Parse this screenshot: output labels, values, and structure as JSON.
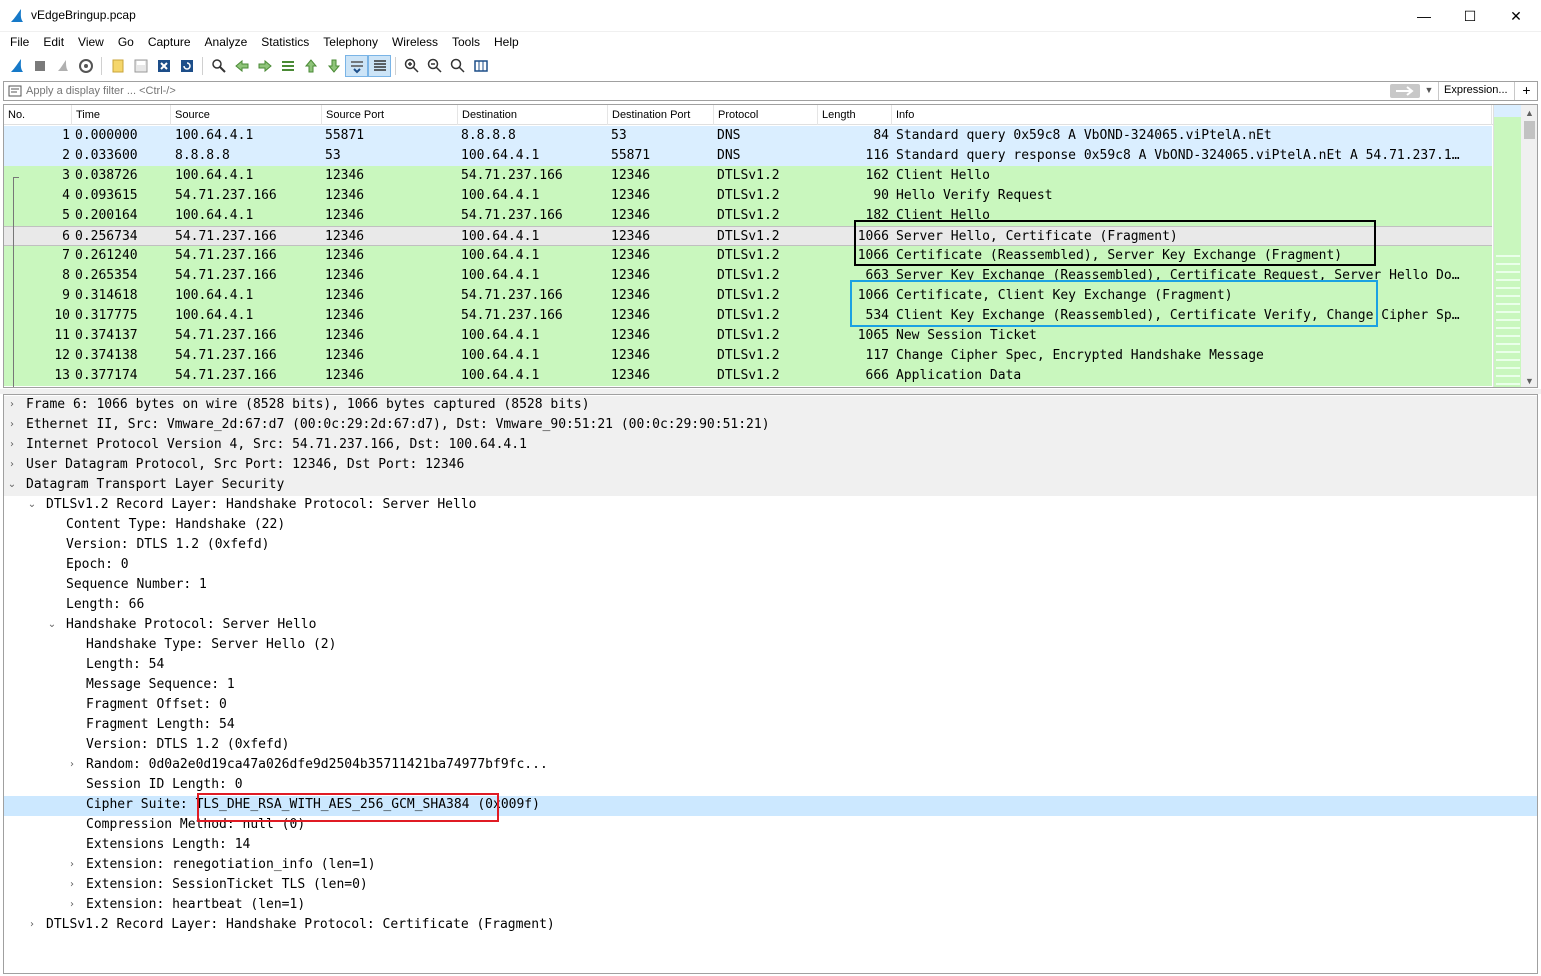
{
  "window": {
    "title": "vEdgeBringup.pcap",
    "minimize_glyph": "—",
    "maximize_glyph": "☐",
    "close_glyph": "✕"
  },
  "menu": [
    "File",
    "Edit",
    "View",
    "Go",
    "Capture",
    "Analyze",
    "Statistics",
    "Telephony",
    "Wireless",
    "Tools",
    "Help"
  ],
  "toolbar": {
    "icons": [
      "shark-start-icon",
      "stop-icon",
      "restart-icon",
      "capture-options-icon",
      "open-file-icon",
      "save-file-icon",
      "close-file-icon",
      "reload-icon",
      "find-icon",
      "go-back-icon",
      "go-forward-icon",
      "go-to-packet-icon",
      "go-first-icon",
      "go-last-icon",
      "autoscroll-icon",
      "colorize-icon",
      "zoom-in-icon",
      "zoom-out-icon",
      "zoom-normal-icon",
      "resize-columns-icon"
    ]
  },
  "filter": {
    "placeholder": "Apply a display filter ... <Ctrl-/>",
    "expression_label": "Expression...",
    "plus_label": "+"
  },
  "packet_list": {
    "columns": [
      "No.",
      "Time",
      "Source",
      "Source Port",
      "Destination",
      "Destination Port",
      "Protocol",
      "Length",
      "Info"
    ],
    "rows": [
      {
        "no": "1",
        "time": "0.000000",
        "src": "100.64.4.1",
        "sport": "55871",
        "dst": "8.8.8.8",
        "dport": "53",
        "proto": "DNS",
        "len": "84",
        "info": "Standard query 0x59c8 A VbOND-324065.viPtelA.nEt"
      },
      {
        "no": "2",
        "time": "0.033600",
        "src": "8.8.8.8",
        "sport": "53",
        "dst": "100.64.4.1",
        "dport": "55871",
        "proto": "DNS",
        "len": "116",
        "info": "Standard query response 0x59c8 A VbOND-324065.viPtelA.nEt A 54.71.237.1…"
      },
      {
        "no": "3",
        "time": "0.038726",
        "src": "100.64.4.1",
        "sport": "12346",
        "dst": "54.71.237.166",
        "dport": "12346",
        "proto": "DTLSv1.2",
        "len": "162",
        "info": "Client Hello"
      },
      {
        "no": "4",
        "time": "0.093615",
        "src": "54.71.237.166",
        "sport": "12346",
        "dst": "100.64.4.1",
        "dport": "12346",
        "proto": "DTLSv1.2",
        "len": "90",
        "info": "Hello Verify Request"
      },
      {
        "no": "5",
        "time": "0.200164",
        "src": "100.64.4.1",
        "sport": "12346",
        "dst": "54.71.237.166",
        "dport": "12346",
        "proto": "DTLSv1.2",
        "len": "182",
        "info": "Client Hello"
      },
      {
        "no": "6",
        "time": "0.256734",
        "src": "54.71.237.166",
        "sport": "12346",
        "dst": "100.64.4.1",
        "dport": "12346",
        "proto": "DTLSv1.2",
        "len": "1066",
        "info": "Server Hello, Certificate (Fragment)"
      },
      {
        "no": "7",
        "time": "0.261240",
        "src": "54.71.237.166",
        "sport": "12346",
        "dst": "100.64.4.1",
        "dport": "12346",
        "proto": "DTLSv1.2",
        "len": "1066",
        "info": "Certificate (Reassembled), Server Key Exchange (Fragment)"
      },
      {
        "no": "8",
        "time": "0.265354",
        "src": "54.71.237.166",
        "sport": "12346",
        "dst": "100.64.4.1",
        "dport": "12346",
        "proto": "DTLSv1.2",
        "len": "663",
        "info": "Server Key Exchange (Reassembled), Certificate Request, Server Hello Do…"
      },
      {
        "no": "9",
        "time": "0.314618",
        "src": "100.64.4.1",
        "sport": "12346",
        "dst": "54.71.237.166",
        "dport": "12346",
        "proto": "DTLSv1.2",
        "len": "1066",
        "info": "Certificate, Client Key Exchange (Fragment)"
      },
      {
        "no": "10",
        "time": "0.317775",
        "src": "100.64.4.1",
        "sport": "12346",
        "dst": "54.71.237.166",
        "dport": "12346",
        "proto": "DTLSv1.2",
        "len": "534",
        "info": "Client Key Exchange (Reassembled), Certificate Verify, Change Cipher Sp…"
      },
      {
        "no": "11",
        "time": "0.374137",
        "src": "54.71.237.166",
        "sport": "12346",
        "dst": "100.64.4.1",
        "dport": "12346",
        "proto": "DTLSv1.2",
        "len": "1065",
        "info": "New Session Ticket"
      },
      {
        "no": "12",
        "time": "0.374138",
        "src": "54.71.237.166",
        "sport": "12346",
        "dst": "100.64.4.1",
        "dport": "12346",
        "proto": "DTLSv1.2",
        "len": "117",
        "info": "Change Cipher Spec, Encrypted Handshake Message"
      },
      {
        "no": "13",
        "time": "0.377174",
        "src": "54.71.237.166",
        "sport": "12346",
        "dst": "100.64.4.1",
        "dport": "12346",
        "proto": "DTLSv1.2",
        "len": "666",
        "info": "Application Data"
      }
    ],
    "selected_no": "6"
  },
  "details": [
    {
      "arrow": "›",
      "text": "Frame 6: 1066 bytes on wire (8528 bits), 1066 bytes captured (8528 bits)"
    },
    {
      "arrow": "›",
      "text": "Ethernet II, Src: Vmware_2d:67:d7 (00:0c:29:2d:67:d7), Dst: Vmware_90:51:21 (00:0c:29:90:51:21)"
    },
    {
      "arrow": "›",
      "text": "Internet Protocol Version 4, Src: 54.71.237.166, Dst: 100.64.4.1"
    },
    {
      "arrow": "›",
      "text": "User Datagram Protocol, Src Port: 12346, Dst Port: 12346"
    },
    {
      "arrow": "⌄",
      "text": "Datagram Transport Layer Security"
    },
    {
      "arrow": "⌄",
      "text": "DTLSv1.2 Record Layer: Handshake Protocol: Server Hello"
    },
    {
      "arrow": "",
      "text": "Content Type: Handshake (22)"
    },
    {
      "arrow": "",
      "text": "Version: DTLS 1.2 (0xfefd)"
    },
    {
      "arrow": "",
      "text": "Epoch: 0"
    },
    {
      "arrow": "",
      "text": "Sequence Number: 1"
    },
    {
      "arrow": "",
      "text": "Length: 66"
    },
    {
      "arrow": "⌄",
      "text": "Handshake Protocol: Server Hello"
    },
    {
      "arrow": "",
      "text": "Handshake Type: Server Hello (2)"
    },
    {
      "arrow": "",
      "text": "Length: 54"
    },
    {
      "arrow": "",
      "text": "Message Sequence: 1"
    },
    {
      "arrow": "",
      "text": "Fragment Offset: 0"
    },
    {
      "arrow": "",
      "text": "Fragment Length: 54"
    },
    {
      "arrow": "",
      "text": "Version: DTLS 1.2 (0xfefd)"
    },
    {
      "arrow": "›",
      "text": "Random: 0d0a2e0d19ca47a026dfe9d2504b35711421ba74977bf9fc..."
    },
    {
      "arrow": "",
      "text": "Session ID Length: 0"
    },
    {
      "arrow": "",
      "text": "Cipher Suite: TLS_DHE_RSA_WITH_AES_256_GCM_SHA384 (0x009f)"
    },
    {
      "arrow": "",
      "text": "Compression Method: null (0)"
    },
    {
      "arrow": "",
      "text": "Extensions Length: 14"
    },
    {
      "arrow": "›",
      "text": "Extension: renegotiation_info (len=1)"
    },
    {
      "arrow": "›",
      "text": "Extension: SessionTicket TLS (len=0)"
    },
    {
      "arrow": "›",
      "text": "Extension: heartbeat (len=1)"
    },
    {
      "arrow": "›",
      "text": "DTLSv1.2 Record Layer: Handshake Protocol: Certificate (Fragment)"
    }
  ],
  "colors": {
    "dns_row": "#daeeff",
    "dtls_row": "#c9f7be",
    "selected_row": "#e9e9e9",
    "selected_detail": "#cce8ff",
    "annotation_black": "#000000",
    "annotation_blue": "#1ba1e2",
    "annotation_red": "#e01b24"
  }
}
